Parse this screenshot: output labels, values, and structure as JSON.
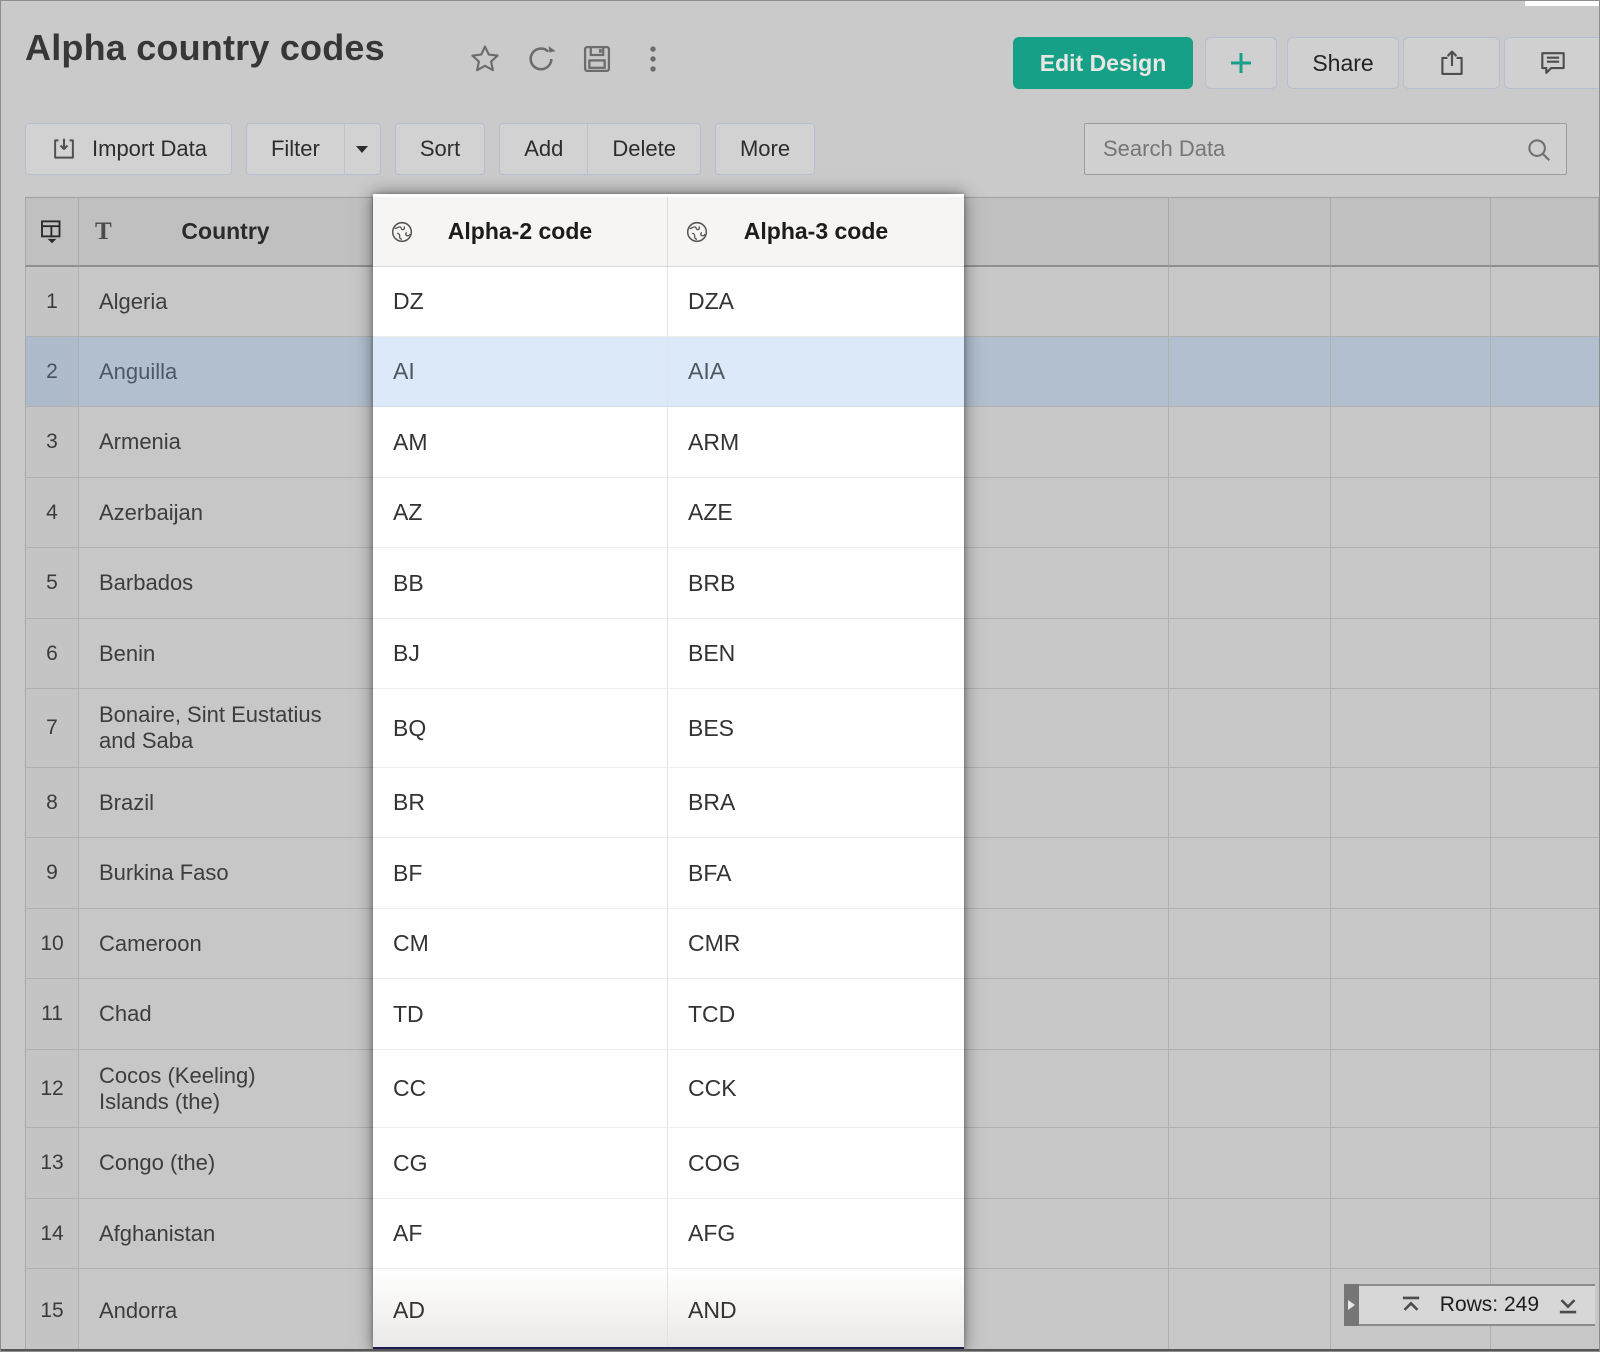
{
  "header": {
    "title": "Alpha country codes",
    "actions": {
      "edit_design": "Edit Design",
      "share": "Share"
    },
    "title_icons": [
      "star-icon",
      "refresh-icon",
      "save-icon",
      "more-vertical-icon"
    ],
    "action_icons": [
      "plus-icon",
      "export-icon",
      "comment-icon"
    ]
  },
  "toolbar": {
    "import_data": "Import Data",
    "filter": "Filter",
    "sort": "Sort",
    "add": "Add",
    "delete": "Delete",
    "more": "More",
    "search_placeholder": "Search Data",
    "icons": [
      "import-icon",
      "caret-down-icon",
      "search-icon"
    ]
  },
  "table": {
    "columns": {
      "country": "Country",
      "alpha2": "Alpha-2 code",
      "alpha3": "Alpha-3 code"
    },
    "column_type_icons": {
      "country": "text-type-icon",
      "alpha2": "globe-icon",
      "alpha3": "globe-icon"
    },
    "selected_row_number": "2",
    "rows": [
      {
        "num": "1",
        "country": "Algeria",
        "alpha2": "DZ",
        "alpha3": "DZA"
      },
      {
        "num": "2",
        "country": "Anguilla",
        "alpha2": "AI",
        "alpha3": "AIA"
      },
      {
        "num": "3",
        "country": "Armenia",
        "alpha2": "AM",
        "alpha3": "ARM"
      },
      {
        "num": "4",
        "country": "Azerbaijan",
        "alpha2": "AZ",
        "alpha3": "AZE"
      },
      {
        "num": "5",
        "country": "Barbados",
        "alpha2": "BB",
        "alpha3": "BRB"
      },
      {
        "num": "6",
        "country": "Benin",
        "alpha2": "BJ",
        "alpha3": "BEN"
      },
      {
        "num": "7",
        "country": "Bonaire, Sint Eustatius and Saba",
        "alpha2": "BQ",
        "alpha3": "BES"
      },
      {
        "num": "8",
        "country": "Brazil",
        "alpha2": "BR",
        "alpha3": "BRA"
      },
      {
        "num": "9",
        "country": "Burkina Faso",
        "alpha2": "BF",
        "alpha3": "BFA"
      },
      {
        "num": "10",
        "country": "Cameroon",
        "alpha2": "CM",
        "alpha3": "CMR"
      },
      {
        "num": "11",
        "country": "Chad",
        "alpha2": "TD",
        "alpha3": "TCD"
      },
      {
        "num": "12",
        "country": "Cocos (Keeling) Islands (the)",
        "alpha2": "CC",
        "alpha3": "CCK"
      },
      {
        "num": "13",
        "country": "Congo (the)",
        "alpha2": "CG",
        "alpha3": "COG"
      },
      {
        "num": "14",
        "country": "Afghanistan",
        "alpha2": "AF",
        "alpha3": "AFG"
      },
      {
        "num": "15",
        "country": "Andorra",
        "alpha2": "AD",
        "alpha3": "AND"
      }
    ]
  },
  "status_bar": {
    "rows_count_label": "Rows: 249",
    "icons": [
      "expand-panel-icon",
      "scroll-to-top-icon",
      "scroll-to-bottom-icon"
    ]
  },
  "colors": {
    "accent_teal": "#16a087",
    "dim_background": "#cacaca",
    "selected_row_dimmed": "#b1bfce",
    "selected_row_spotlight": "#dce9f8",
    "spotlight_bottom_line": "#1d1d52"
  }
}
